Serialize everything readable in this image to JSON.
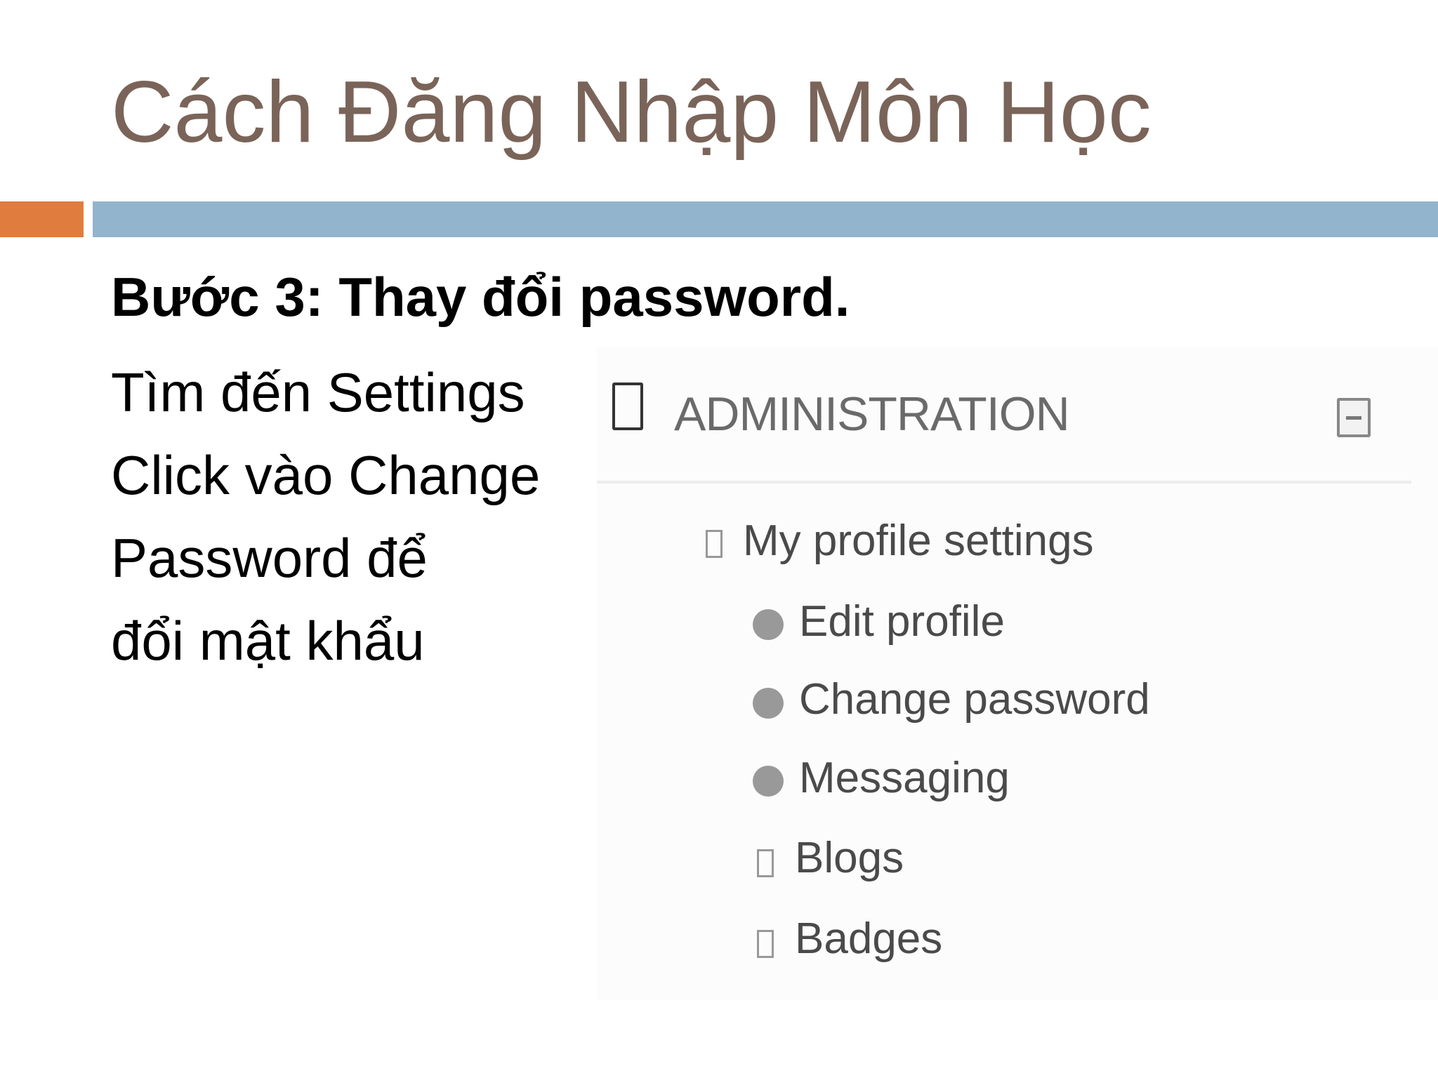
{
  "slide": {
    "title": "Cách Đăng Nhập Môn Học",
    "step_heading": "Bước 3: Thay đổi password.",
    "description_lines": [
      "Tìm đến Settings",
      "Click vào Change",
      "Password để",
      "đổi mật khẩu"
    ],
    "colors": {
      "title": "#7a6459",
      "accent_bar": "#e07c3e",
      "main_bar": "#93b4cd"
    }
  },
  "panel": {
    "title": "ADMINISTRATION",
    "section": "My profile settings",
    "items": [
      "Edit profile",
      "Change password",
      "Messaging"
    ],
    "subsections": [
      "Blogs",
      "Badges"
    ]
  }
}
